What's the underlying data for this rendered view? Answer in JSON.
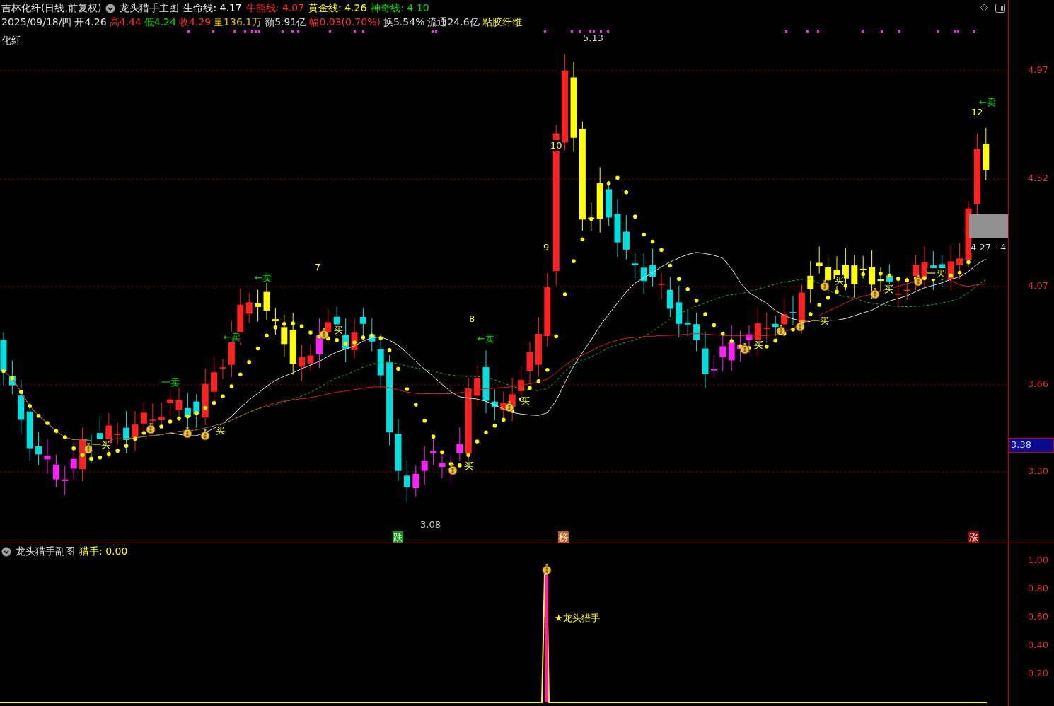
{
  "header": {
    "stock": "吉林化纤",
    "period": "(日线,前复权)",
    "indicator": "龙头猎手主图",
    "lines": [
      {
        "label": "生命线:",
        "value": "4.17",
        "color": "#ffffff"
      },
      {
        "label": "牛熊线:",
        "value": "4.07",
        "color": "#ff3030"
      },
      {
        "label": "黄金线:",
        "value": "4.26",
        "color": "#ffff00"
      },
      {
        "label": "神奇线:",
        "value": "4.10",
        "color": "#00e000"
      }
    ]
  },
  "quote": [
    {
      "text": "2025/09/18/四",
      "color": "#e0e0e0"
    },
    {
      "text": "开4.26",
      "color": "#e0e0e0"
    },
    {
      "text": "高4.44",
      "color": "#ff3030"
    },
    {
      "text": "低4.24",
      "color": "#00e000"
    },
    {
      "text": "收4.29",
      "color": "#ff3030"
    },
    {
      "text": "量136.1万",
      "color": "#e0c000"
    },
    {
      "text": "额5.91亿",
      "color": "#e0e0e0"
    },
    {
      "text": "幅0.03(0.70%)",
      "color": "#ff3030"
    },
    {
      "text": "换5.54%",
      "color": "#e0e0e0"
    },
    {
      "text": "流通24.6亿",
      "color": "#e0e0e0"
    },
    {
      "text": "粘胶纤维",
      "color": "#ffff00"
    }
  ],
  "chart_label": "化纤",
  "marks": [
    {
      "kind": "count",
      "text": "7"
    },
    {
      "kind": "count",
      "text": "8"
    },
    {
      "kind": "count",
      "text": "9"
    },
    {
      "kind": "count",
      "text": "10"
    },
    {
      "kind": "count",
      "text": "12"
    },
    {
      "kind": "sell",
      "text": "←卖"
    },
    {
      "kind": "sell",
      "text": "←卖"
    },
    {
      "kind": "sell",
      "text": "←卖"
    },
    {
      "kind": "sell",
      "text": "←卖"
    },
    {
      "kind": "sell",
      "text": "一卖"
    },
    {
      "kind": "buy",
      "text": "一买"
    },
    {
      "kind": "buy",
      "text": "买"
    },
    {
      "kind": "buy",
      "text": "买"
    },
    {
      "kind": "buy",
      "text": "买"
    },
    {
      "kind": "buy",
      "text": "买"
    },
    {
      "kind": "buy",
      "text": "买"
    },
    {
      "kind": "buy",
      "text": "一买"
    },
    {
      "kind": "buy",
      "text": "买"
    },
    {
      "kind": "buy",
      "text": "买"
    },
    {
      "kind": "buy",
      "text": "一买"
    },
    {
      "kind": "price",
      "text": "5.13"
    },
    {
      "kind": "price",
      "text": "3.08"
    },
    {
      "kind": "price",
      "text": "4.27 - 4"
    },
    {
      "kind": "badge",
      "text": "跌",
      "color": "#10a010"
    },
    {
      "kind": "badge",
      "text": "榜",
      "color": "#c06010"
    },
    {
      "kind": "badge",
      "text": "涨",
      "color": "#900000"
    }
  ],
  "price_axis": [
    "4.97",
    "4.52",
    "4.07",
    "3.66",
    "3.30"
  ],
  "cursor_price": "3.38",
  "sub": {
    "title": "龙头猎手副图",
    "value": "猎手: 0.00",
    "signal": "★龙头猎手",
    "axis": [
      "1.00",
      "0.80",
      "0.60",
      "0.40",
      "0.20"
    ]
  }
}
